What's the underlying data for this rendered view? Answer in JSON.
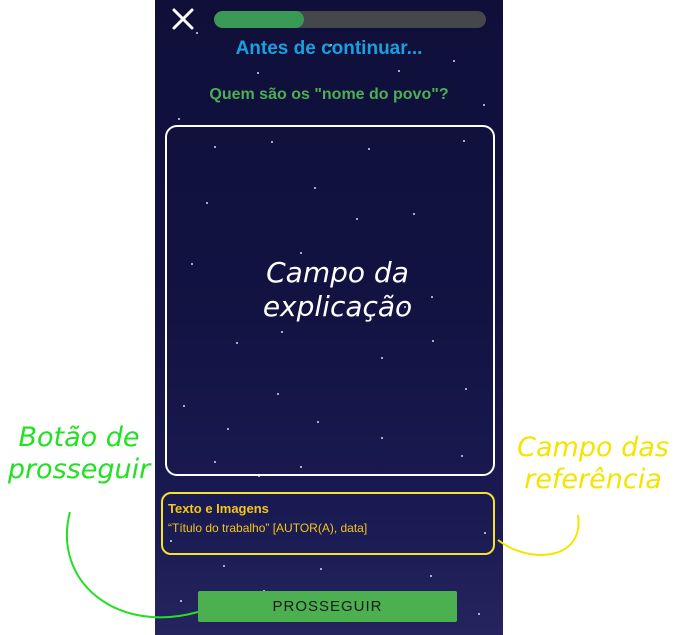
{
  "header": {
    "close_icon": "close-icon",
    "progress_fraction": 0.33
  },
  "title": "Antes de continuar...",
  "question": "Quem são os \"nome do povo\"?",
  "references": {
    "title": "Texto e Imagens",
    "text": "“Título do trabalho” [AUTOR(A), data]"
  },
  "proceed_button": {
    "label": "PROSSEGUIR"
  },
  "annotations": {
    "explanation_line1": "Campo da",
    "explanation_line2": "explicação",
    "proceed_line1": "Botão de",
    "proceed_line2": "prosseguir",
    "references_line1": "Campo das",
    "references_line2": "referência"
  },
  "colors": {
    "title": "#1a9fe0",
    "question": "#4caf50",
    "references_border": "#f7e02f",
    "references_text": "#f5c518",
    "button": "#4caf50",
    "annotation_proceed": "#22e022",
    "annotation_references": "#f5e400"
  }
}
